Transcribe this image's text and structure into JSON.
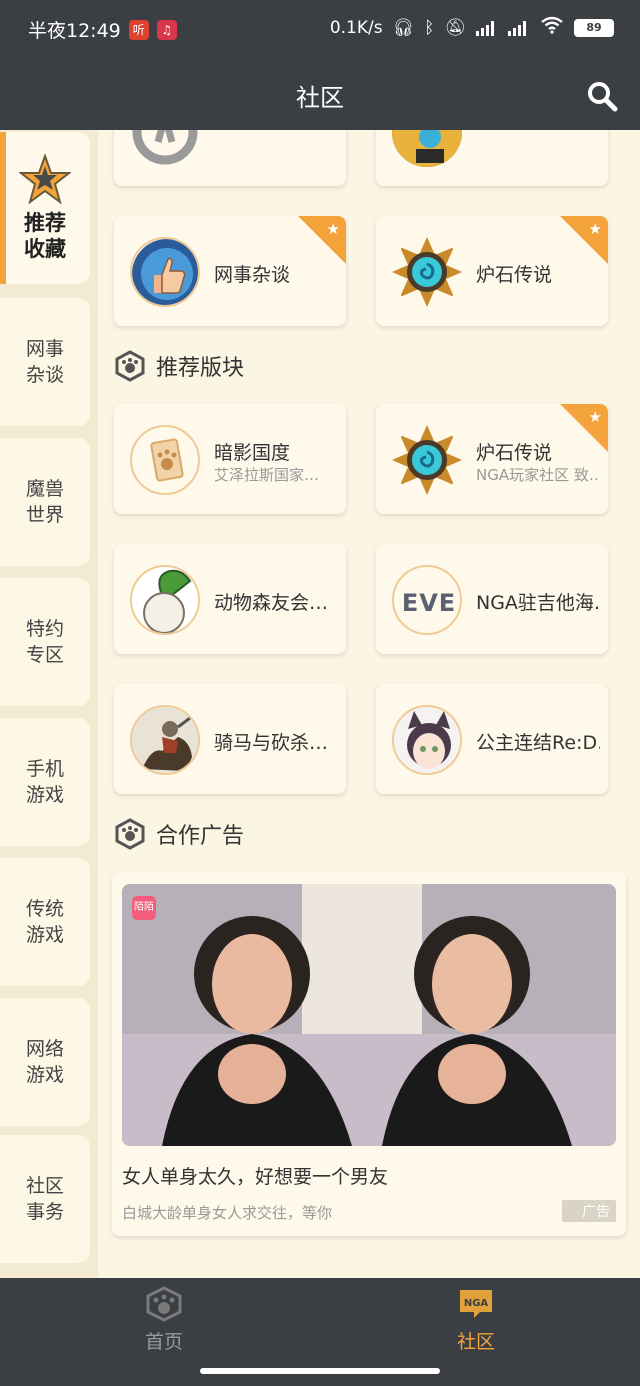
{
  "status_bar": {
    "time": "半夜12:49",
    "app_badge_1": "听",
    "network_speed": "0.1K/s",
    "battery": "89"
  },
  "header": {
    "title": "社区"
  },
  "sidebar": {
    "items": [
      {
        "label": "推荐\n收藏",
        "active": true
      },
      {
        "label": "网事\n杂谈"
      },
      {
        "label": "魔兽\n世界"
      },
      {
        "label": "特约\n专区"
      },
      {
        "label": "手机\n游戏"
      },
      {
        "label": "传统\n游戏"
      },
      {
        "label": "网络\n游戏"
      },
      {
        "label": "社区\n事务"
      }
    ]
  },
  "favorites": [
    {
      "name": "网事杂谈",
      "icon": "thumbs-up-icon",
      "starred": true
    },
    {
      "name": "炉石传说",
      "icon": "hearthstone-icon",
      "starred": true
    }
  ],
  "recommended": {
    "title": "推荐版块",
    "boards": [
      {
        "name": "暗影国度",
        "desc": "艾泽拉斯国家…",
        "icon": "paw-card-icon",
        "starred": false
      },
      {
        "name": "炉石传说",
        "desc": "NGA玩家社区 致…",
        "icon": "hearthstone-icon",
        "starred": true
      },
      {
        "name": "动物森友会…",
        "icon": "turnip-icon",
        "starred": false
      },
      {
        "name": "NGA驻吉他海…",
        "icon": "eve-icon",
        "starred": false
      },
      {
        "name": "骑马与砍杀…",
        "icon": "knight-icon",
        "starred": false
      },
      {
        "name": "公主连结Re:D…",
        "icon": "catgirl-icon",
        "starred": false
      }
    ]
  },
  "ads": {
    "title": "合作广告",
    "badge": "陌陌",
    "ad_title": "女人单身太久，好想要一个男友",
    "ad_sub": "白城大龄单身女人求交往，等你",
    "tag": "广告"
  },
  "bottom_nav": {
    "items": [
      {
        "label": "首页",
        "active": false
      },
      {
        "label": "社区",
        "active": true
      }
    ],
    "nga_badge": "NGA"
  },
  "colors": {
    "dark_bar": "#3b3f43",
    "accent": "#f3a33a",
    "background": "#fbf5e3"
  }
}
